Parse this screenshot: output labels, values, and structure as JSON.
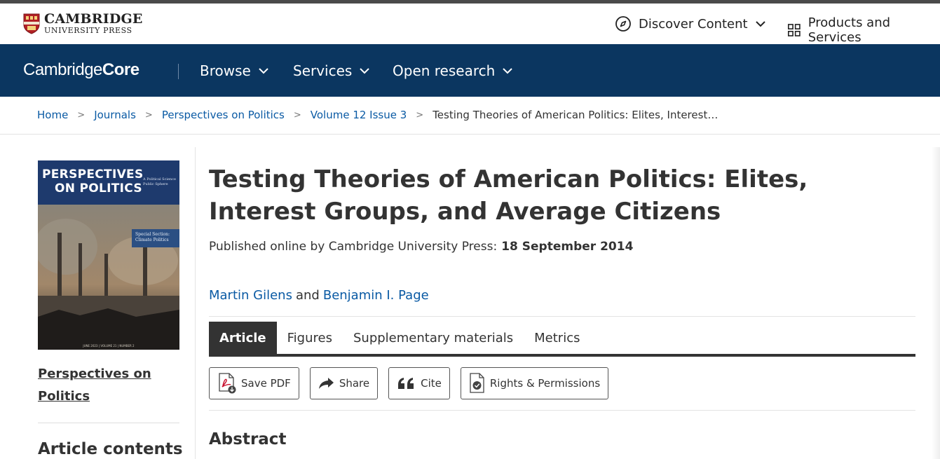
{
  "publisher": {
    "line1": "CAMBRIDGE",
    "line2": "UNIVERSITY PRESS"
  },
  "top_nav": {
    "discover": "Discover Content",
    "products": "Products and Services"
  },
  "core_logo": {
    "part1": "Cambridge",
    "part2": "Core"
  },
  "main_nav": {
    "browse": "Browse",
    "services": "Services",
    "open_research": "Open research"
  },
  "breadcrumb": {
    "home": "Home",
    "journals": "Journals",
    "journal": "Perspectives on Politics",
    "issue": "Volume 12 Issue 3",
    "current": "Testing Theories of American Politics: Elites, Interest…",
    "separator": ">"
  },
  "cover": {
    "title_line1": "PERSPECTIVES",
    "title_line2": "ON POLITICS",
    "subtitle": "A Political Science Public Sphere",
    "special_section": "Special Section: Climate Politics",
    "footer": "JUNE 2023 | VOLUME 21 | NUMBER 2"
  },
  "sidebar": {
    "journal_link_line1": "Perspectives on",
    "journal_link_line2": "Politics",
    "contents_heading": "Article contents"
  },
  "article": {
    "title": "Testing Theories of American Politics: Elites, Interest Groups, and Average Citizens",
    "published_label": "Published online by Cambridge University Press:",
    "published_date": "18 September 2014",
    "author1": "Martin Gilens",
    "and": "and",
    "author2": "Benjamin I. Page"
  },
  "tabs": [
    "Article",
    "Figures",
    "Supplementary materials",
    "Metrics"
  ],
  "actions": {
    "save_pdf": "Save PDF",
    "share": "Share",
    "cite": "Cite",
    "rights": "Rights & Permissions"
  },
  "abstract_heading": "Abstract",
  "colors": {
    "navy": "#0b3660",
    "link": "#0a5aa4",
    "dark": "#333333"
  }
}
